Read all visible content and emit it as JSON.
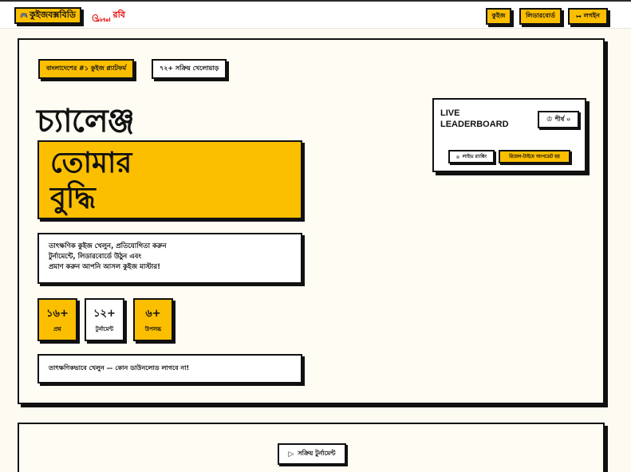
{
  "header": {
    "brand_icon": "🎮",
    "brand_label": "কুইজবক্সবিডি",
    "partner_swirl": "ᘓ",
    "partner_word": "airtel",
    "partner_robi": "রবি",
    "nav": {
      "quiz": "কুইজ",
      "leaderboard": "লিডারবোর্ড",
      "login_icon": "↦",
      "login": "লগইন"
    }
  },
  "hero": {
    "tag_platform": "বাংলাদেশের #১ কুইজ প্ল্যাটফর্ম",
    "tag_players": "৭২+ সক্রিয় খেলোয়াড়",
    "headline_1": "চ্যালেঞ্জ",
    "headline_2": "তোমার",
    "headline_3": "বুদ্ধি",
    "desc_line1": "তাৎক্ষণিক কুইজ খেলুন, প্রতিযোগিতা করুন",
    "desc_line2": "টুর্নামেন্টে, লিডারবোর্ডে উঠুন এবং",
    "desc_line3": "প্রমাণ করুন আপনি আসল কুইজ মাস্টার!",
    "stats": [
      {
        "num": "১৬+",
        "label": "প্রশ্ন"
      },
      {
        "num": "১২+",
        "label": "টুর্নামেন্ট"
      },
      {
        "num": "৬+",
        "label": "উপলব্ধ"
      }
    ],
    "play_note": "তাৎক্ষণিকভাবে খেলুন — কোন ডাউনলোড লাগবে না!"
  },
  "leaderboard_card": {
    "title_1": "LIVE",
    "title_2": "LEADERBOARD",
    "top_icon": "♔",
    "top_label": "শীর্ষ ০",
    "live_ranking": "লাইভ র‍্যাঙ্কিং",
    "realtime": "রিয়েল-টাইমে আপডেট হয়"
  },
  "section2": {
    "play_icon": "▷",
    "active_tournaments": "সক্রিয় টুর্নামেন্ট"
  },
  "colors": {
    "accent": "#fcbf00",
    "ink": "#111111",
    "page_bg": "#fdfaf1",
    "brand_red": "#e60000"
  }
}
